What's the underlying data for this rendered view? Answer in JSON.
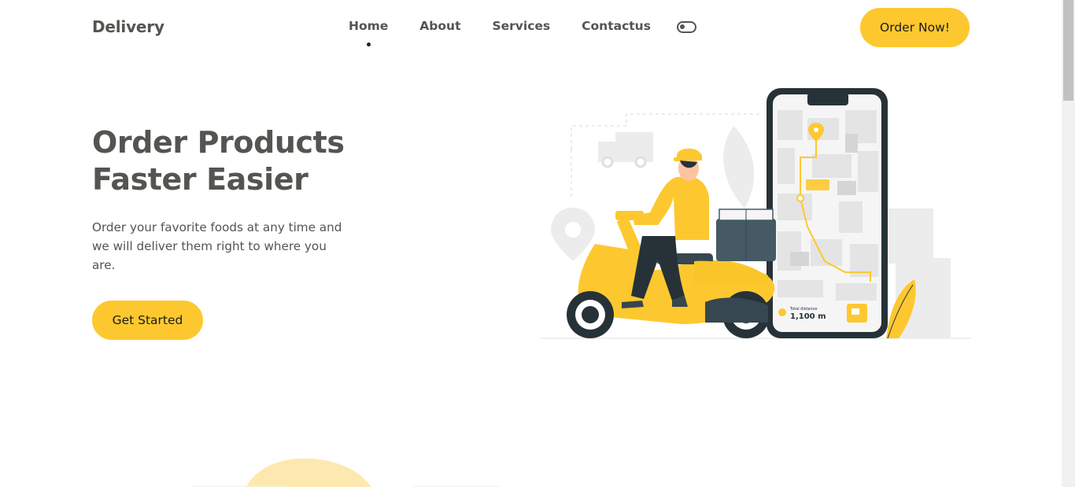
{
  "header": {
    "logo": "Delivery",
    "nav": [
      {
        "label": "Home",
        "active": true
      },
      {
        "label": "About",
        "active": false
      },
      {
        "label": "Services",
        "active": false
      },
      {
        "label": "Contactus",
        "active": false
      }
    ],
    "toggle_icon": "toggle-icon",
    "order_button": "Order Now!"
  },
  "hero": {
    "title": "Order Products Faster Easier",
    "description": "Order your favorite foods at any time and we will deliver them right to where you are.",
    "cta": "Get Started",
    "illustration": {
      "distance_label": "Total distance",
      "distance_value": "1,100 m"
    }
  },
  "colors": {
    "accent": "#fdc82f",
    "text": "#555450",
    "dark": "#37474f"
  }
}
